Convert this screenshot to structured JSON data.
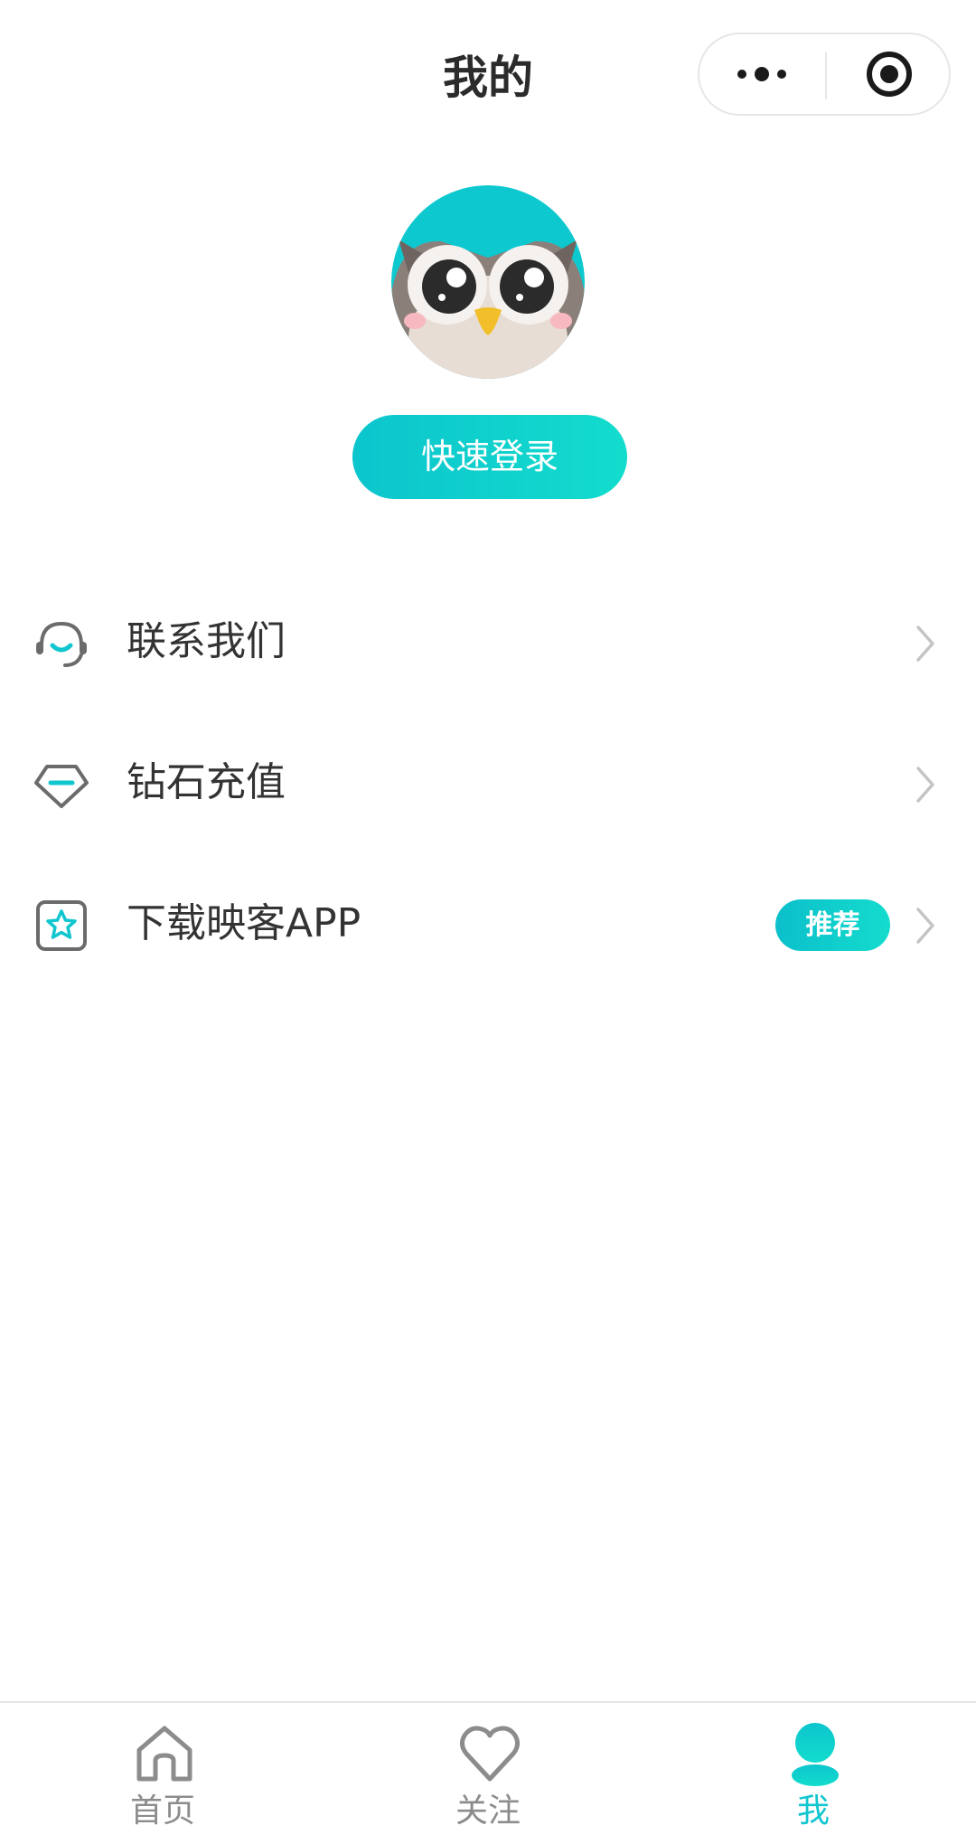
{
  "header": {
    "title": "我的",
    "capsule": {
      "more_icon": "more-dots-icon",
      "close_icon": "target-circle-icon"
    }
  },
  "profile": {
    "avatar_icon": "owl-avatar",
    "login_label": "快速登录"
  },
  "menu": {
    "items": [
      {
        "label": "联系我们",
        "icon": "headset-icon"
      },
      {
        "label": "钻石充值",
        "icon": "diamond-icon"
      },
      {
        "label": "下载映客APP",
        "icon": "star-box-icon",
        "badge": "推荐"
      }
    ]
  },
  "tabbar": {
    "tabs": [
      {
        "label": "首页",
        "icon": "home-icon",
        "active": false
      },
      {
        "label": "关注",
        "icon": "heart-icon",
        "active": false
      },
      {
        "label": "我",
        "icon": "person-icon",
        "active": true
      }
    ]
  },
  "colors": {
    "accent": "#11c6cf",
    "accent_gradient_end": "#13dccd",
    "text_primary": "#333333",
    "text_inactive": "#8c8c8c"
  }
}
